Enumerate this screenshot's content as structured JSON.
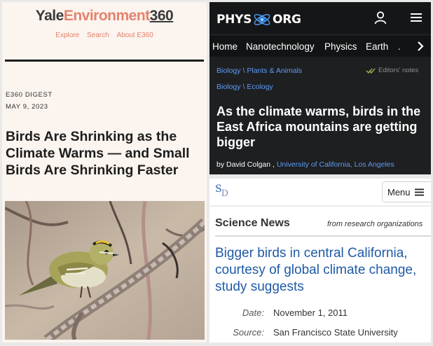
{
  "yale": {
    "logo_part1": "Yale",
    "logo_part2": "Environment",
    "logo_part3": "360",
    "nav": [
      "Explore",
      "Search",
      "About E360"
    ],
    "section": "E360 DIGEST",
    "date": "MAY 9, 2023",
    "headline": "Birds Are Shrinking as the Climate Warms — and Small Birds Are Shrinking Faster",
    "photo_icon": "kinglet-bird-photo"
  },
  "phys": {
    "logo_left": "PHYS",
    "logo_right": "ORG",
    "nav": [
      "Home",
      "Nanotechnology",
      "Physics",
      "Earth",
      "."
    ],
    "breadcrumb1": [
      "Biology",
      "Plants & Animals"
    ],
    "breadcrumb2": [
      "Biology",
      "Ecology"
    ],
    "breadcrumb_sep": "\\",
    "editors_note": "Editors' notes",
    "headline": "As the climate warms, birds in the East Africa mountains are getting bigger",
    "byline_prefix": "by David Colgan ,",
    "byline_institution": "University of California, Los Angeles",
    "icons": [
      "user-icon",
      "menu-icon",
      "chevron-right-icon",
      "check-icon"
    ]
  },
  "sd": {
    "logo_s": "S",
    "logo_d": "D",
    "menu_label": "Menu",
    "section": "Science News",
    "from": "from research organizations",
    "headline": "Bigger birds in central California, courtesy of global climate change, study suggests",
    "date_label": "Date:",
    "date_value": "November 1, 2011",
    "source_label": "Source:",
    "source_value": "San Francisco State University",
    "colors": {
      "headline": "#1f5aa6"
    }
  },
  "colors": {
    "yale_accent": "#e4826d",
    "phys_link": "#5d9cf5",
    "phys_bg": "#1e1f21"
  }
}
